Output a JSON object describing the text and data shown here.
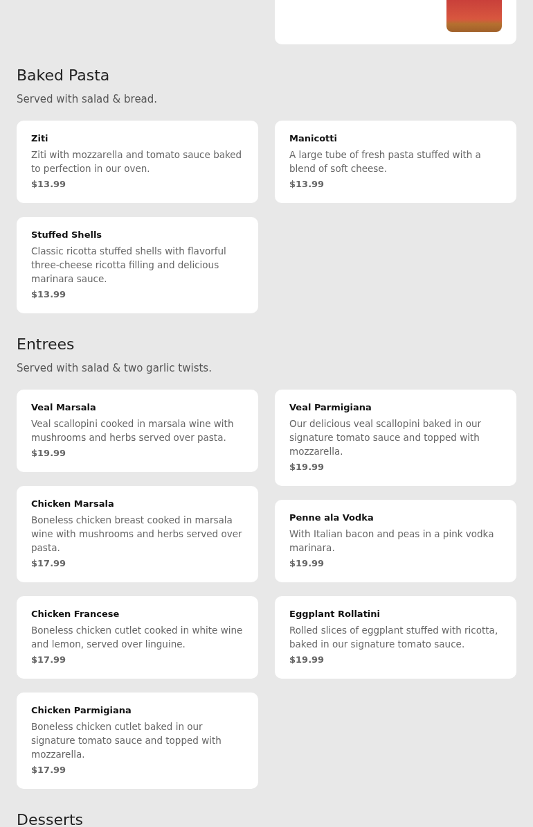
{
  "top_card": {
    "photo": true
  },
  "sections": [
    {
      "title": "Baked Pasta",
      "subtitle": "Served with salad & bread.",
      "columns": [
        {
          "items": [
            {
              "name": "Ziti",
              "description": "Ziti with mozzarella and tomato sauce baked to perfection in our oven.",
              "price": "$13.99"
            },
            {
              "name": "Stuffed Shells",
              "description": "Classic ricotta stuffed shells with flavorful three-cheese ricotta filling and delicious marinara sauce.",
              "price": "$13.99"
            }
          ]
        },
        {
          "items": [
            {
              "name": "Manicotti",
              "description": "A large tube of fresh pasta stuffed with a blend of soft cheese.",
              "price": "$13.99"
            }
          ]
        }
      ]
    },
    {
      "title": "Entrees",
      "subtitle": "Served with salad & two garlic twists.",
      "columns": [
        {
          "items": [
            {
              "name": "Veal Marsala",
              "description": "Veal scallopini cooked in marsala wine with mushrooms and herbs served over pasta.",
              "price": "$19.99"
            },
            {
              "name": "Chicken Marsala",
              "description": "Boneless chicken breast cooked in marsala wine with mushrooms and herbs served over pasta.",
              "price": "$17.99"
            },
            {
              "name": "Chicken Francese",
              "description": "Boneless chicken cutlet cooked in white wine and lemon, served over linguine.",
              "price": "$17.99"
            },
            {
              "name": "Chicken Parmigiana",
              "description": "Boneless chicken cutlet baked in our signature tomato sauce and topped with mozzarella.",
              "price": "$17.99"
            }
          ]
        },
        {
          "items": [
            {
              "name": "Veal Parmigiana",
              "description": "Our delicious veal scallopini baked in our signature tomato sauce and topped with mozzarella.",
              "price": "$19.99"
            },
            {
              "name": "Penne ala Vodka",
              "description": "With Italian bacon and peas in a pink vodka marinara.",
              "price": "$19.99"
            },
            {
              "name": "Eggplant Rollatini",
              "description": "Rolled slices of eggplant stuffed with ricotta, baked in our signature tomato sauce.",
              "price": "$19.99"
            }
          ]
        }
      ]
    },
    {
      "title": "Desserts"
    }
  ]
}
